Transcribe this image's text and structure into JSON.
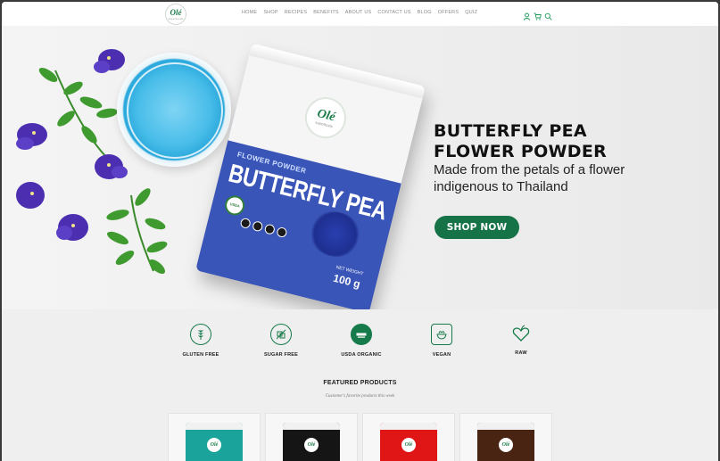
{
  "header": {
    "logo": {
      "brand": "Olé",
      "sub": "superfoods"
    },
    "nav": [
      "HOME",
      "SHOP",
      "RECIPES",
      "BENEFITS",
      "ABOUT US",
      "CONTACT US",
      "BLOG",
      "OFFERS",
      "QUIZ"
    ],
    "icons": [
      "user-icon",
      "cart-icon",
      "search-icon"
    ],
    "accent_color": "#1e7c4a"
  },
  "hero": {
    "title_line1": "BUTTERFLY PEA",
    "title_line2": "FLOWER POWDER",
    "subtitle": "Made from the petals of a flower indigenous to Thailand",
    "cta": "SHOP NOW",
    "cta_color": "#167247",
    "pouch": {
      "logo_brand": "Olé",
      "logo_sub": "superfoods",
      "label": "FLOWER POWDER",
      "title": "BUTTERFLY PEA",
      "badge": "USDA",
      "net_label": "NET WEIGHT",
      "weight": "100 g"
    }
  },
  "features": [
    {
      "label": "GLUTEN FREE",
      "icon": "wheat-icon"
    },
    {
      "label": "SUGAR FREE",
      "icon": "no-sugar-icon"
    },
    {
      "label": "USDA ORGANIC",
      "icon": "usda-organic-icon"
    },
    {
      "label": "VEGAN",
      "icon": "vegan-bowl-icon"
    },
    {
      "label": "RAW",
      "icon": "heart-leaf-icon"
    }
  ],
  "featured": {
    "title": "FEATURED PRODUCTS",
    "subtitle": "Customer's favorite products this week",
    "products": [
      {
        "color": "#1aa39a",
        "logo": "Olé"
      },
      {
        "color": "#151515",
        "logo": "Olé"
      },
      {
        "color": "#e01515",
        "logo": "Olé"
      },
      {
        "color": "#4a2412",
        "logo": "Olé"
      }
    ]
  }
}
